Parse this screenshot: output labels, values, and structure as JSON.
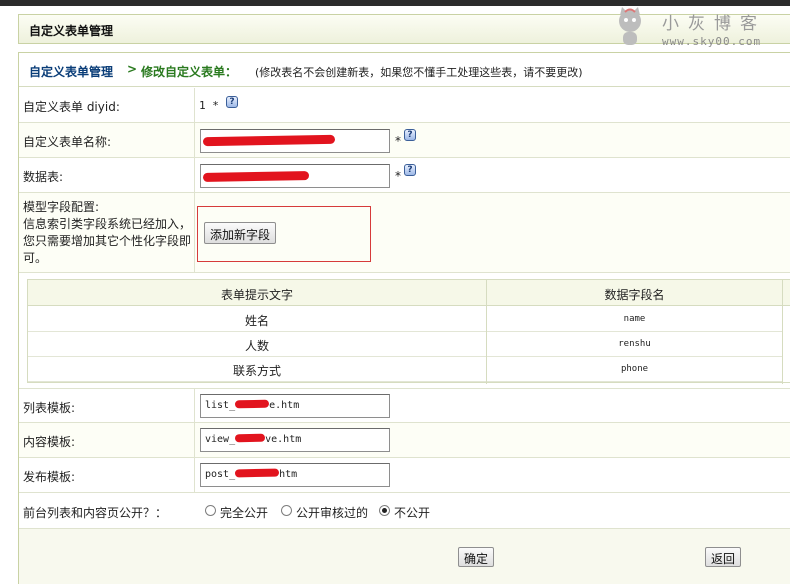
{
  "header": {
    "title": "自定义表单管理"
  },
  "watermark": {
    "brand": "小灰博客",
    "url": "www.sky00.com"
  },
  "breadcrumb": {
    "home": "自定义表单管理",
    "separator": ">",
    "current": "修改自定义表单：",
    "note": "(修改表名不会创建新表，如果您不懂手工处理这些表，请不要更改)"
  },
  "form": {
    "diyid": {
      "label": "自定义表单 diyid:",
      "value": "1 *"
    },
    "name": {
      "label": "自定义表单名称:",
      "star": "*"
    },
    "table": {
      "label": "数据表:",
      "star": "*"
    },
    "fields": {
      "label_lines": [
        "模型字段配置:",
        "信息索引类字段系统已经加入，",
        "您只需要增加其它个性化字段即",
        "可。"
      ],
      "add_button": "添加新字段"
    },
    "list_tpl": {
      "label": "列表模板:",
      "prefix": "list_",
      "suffix": "e.htm"
    },
    "view_tpl": {
      "label": "内容模板:",
      "prefix": "view_",
      "suffix": "ve.htm"
    },
    "post_tpl": {
      "label": "发布模板:",
      "prefix": "post_",
      "suffix": "htm"
    },
    "visibility": {
      "label": "前台列表和内容页公开？：",
      "options": [
        "完全公开",
        "公开审核过的",
        "不公开"
      ],
      "selected": "不公开"
    }
  },
  "field_table": {
    "headers": [
      "表单提示文字",
      "数据字段名"
    ],
    "rows": [
      {
        "label": "姓名",
        "field": "name"
      },
      {
        "label": "人数",
        "field": "renshu"
      },
      {
        "label": "联系方式",
        "field": "phone"
      }
    ]
  },
  "buttons": {
    "confirm": "确定",
    "back": "返回"
  },
  "colors": {
    "link": "#0a3d78",
    "current": "#2a7a1f",
    "redaction": "#e2141e",
    "highlight_box": "#d63b3b"
  }
}
